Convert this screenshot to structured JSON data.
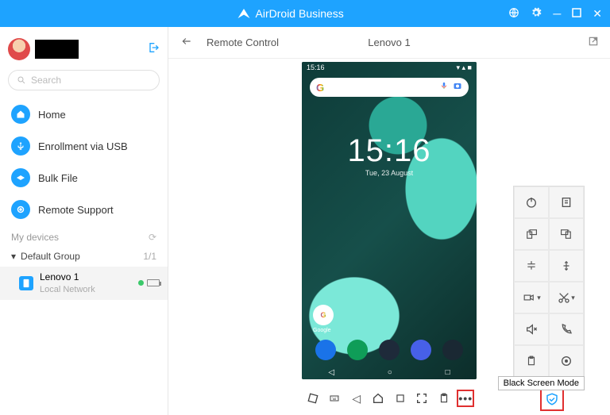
{
  "app": {
    "title": "AirDroid Business"
  },
  "sidebar": {
    "search_placeholder": "Search",
    "nav": [
      {
        "label": "Home"
      },
      {
        "label": "Enrollment via USB"
      },
      {
        "label": "Bulk File"
      },
      {
        "label": "Remote Support"
      }
    ],
    "devices_label": "My devices",
    "group": {
      "name": "Default Group",
      "count": "1/1"
    },
    "device": {
      "name": "Lenovo 1",
      "network": "Local Network"
    }
  },
  "header": {
    "section": "Remote Control",
    "device_name": "Lenovo 1"
  },
  "phone": {
    "status_time": "15:16",
    "clock_time": "15:16",
    "clock_date": "Tue, 23 August",
    "google_label": "Google"
  },
  "tooltip": "Black Screen Mode",
  "side_panel_tools": [
    "power",
    "files",
    "rotate-left",
    "rotate-right",
    "volume-down",
    "volume-up",
    "record",
    "cut",
    "mute",
    "call",
    "clipboard",
    "location"
  ]
}
